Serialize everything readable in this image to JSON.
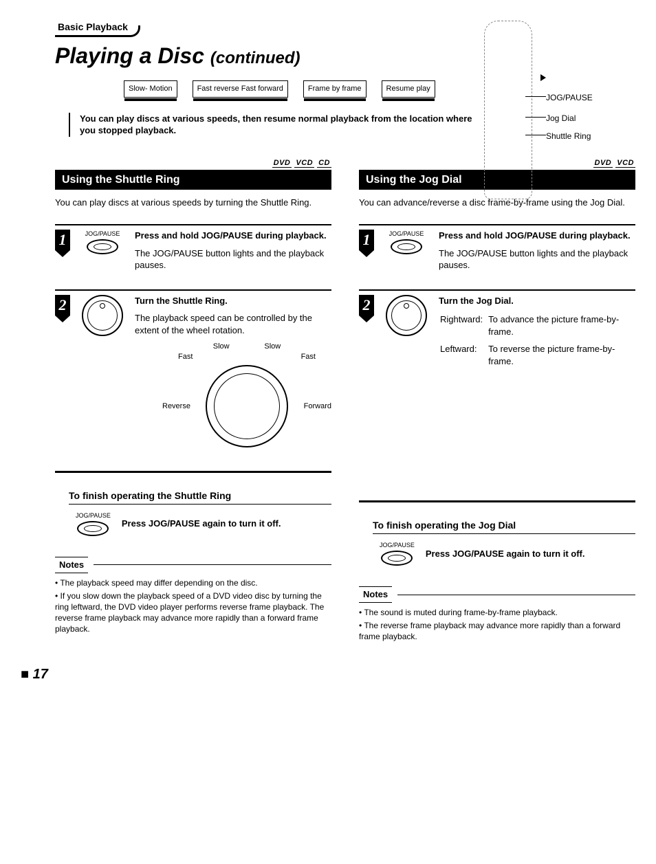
{
  "section_tag": "Basic Playback",
  "title_main": "Playing a Disc",
  "title_cont": "(continued)",
  "features": [
    "Slow-\nMotion",
    "Fast reverse\nFast forward",
    "Frame by\nframe",
    "Resume\nplay"
  ],
  "intro": "You can play discs at various speeds, then resume normal playback from the location where you stopped playback.",
  "remote_labels": {
    "jog_pause": "JOG/PAUSE",
    "jog_dial": "Jog Dial",
    "shuttle_ring": "Shuttle Ring"
  },
  "left": {
    "disc_tags": [
      "DVD",
      "VCD",
      "CD"
    ],
    "bar": "Using the Shuttle Ring",
    "lead": "You can play discs at various speeds by turning the Shuttle Ring.",
    "steps": [
      {
        "icon_label": "JOG/PAUSE",
        "icon_type": "oval",
        "heading": "Press and hold JOG/PAUSE during playback.",
        "body": "The JOG/PAUSE button lights and the playback pauses."
      },
      {
        "icon_label": "",
        "icon_type": "dial",
        "heading": "Turn the Shuttle Ring.",
        "body": "The playback speed can be controlled by the extent of the wheel rotation."
      }
    ],
    "diagram": {
      "slow": "Slow",
      "fast": "Fast",
      "reverse": "Reverse",
      "forward": "Forward"
    },
    "finish_h": "To finish operating the Shuttle Ring",
    "finish_label": "JOG/PAUSE",
    "finish_text": "Press JOG/PAUSE again to turn it off.",
    "notes_h": "Notes",
    "notes": [
      "The playback speed may differ depending on the disc.",
      "If you slow down the playback speed of a DVD video disc by turning the ring leftward, the DVD video player performs reverse frame playback. The reverse frame playback may advance more rapidly than a forward frame playback."
    ]
  },
  "right": {
    "disc_tags": [
      "DVD",
      "VCD"
    ],
    "bar": "Using the Jog Dial",
    "lead": "You can advance/reverse a disc frame-by-frame using the Jog Dial.",
    "steps": [
      {
        "icon_label": "JOG/PAUSE",
        "icon_type": "oval",
        "heading": "Press and hold JOG/PAUSE during playback.",
        "body": "The JOG/PAUSE button lights and the playback pauses."
      },
      {
        "icon_label": "",
        "icon_type": "dial",
        "heading": "Turn the Jog Dial.",
        "body": ""
      }
    ],
    "dir": {
      "r_label": "Rightward:",
      "r_text": "To advance the picture frame-by-frame.",
      "l_label": "Leftward:",
      "l_text": "To reverse the picture frame-by-frame."
    },
    "finish_h": "To finish operating the Jog Dial",
    "finish_label": "JOG/PAUSE",
    "finish_text": "Press JOG/PAUSE again to turn it off.",
    "notes_h": "Notes",
    "notes": [
      "The sound is muted during frame-by-frame playback.",
      "The reverse frame playback may advance more rapidly than a forward frame playback."
    ]
  },
  "page_number": "17"
}
